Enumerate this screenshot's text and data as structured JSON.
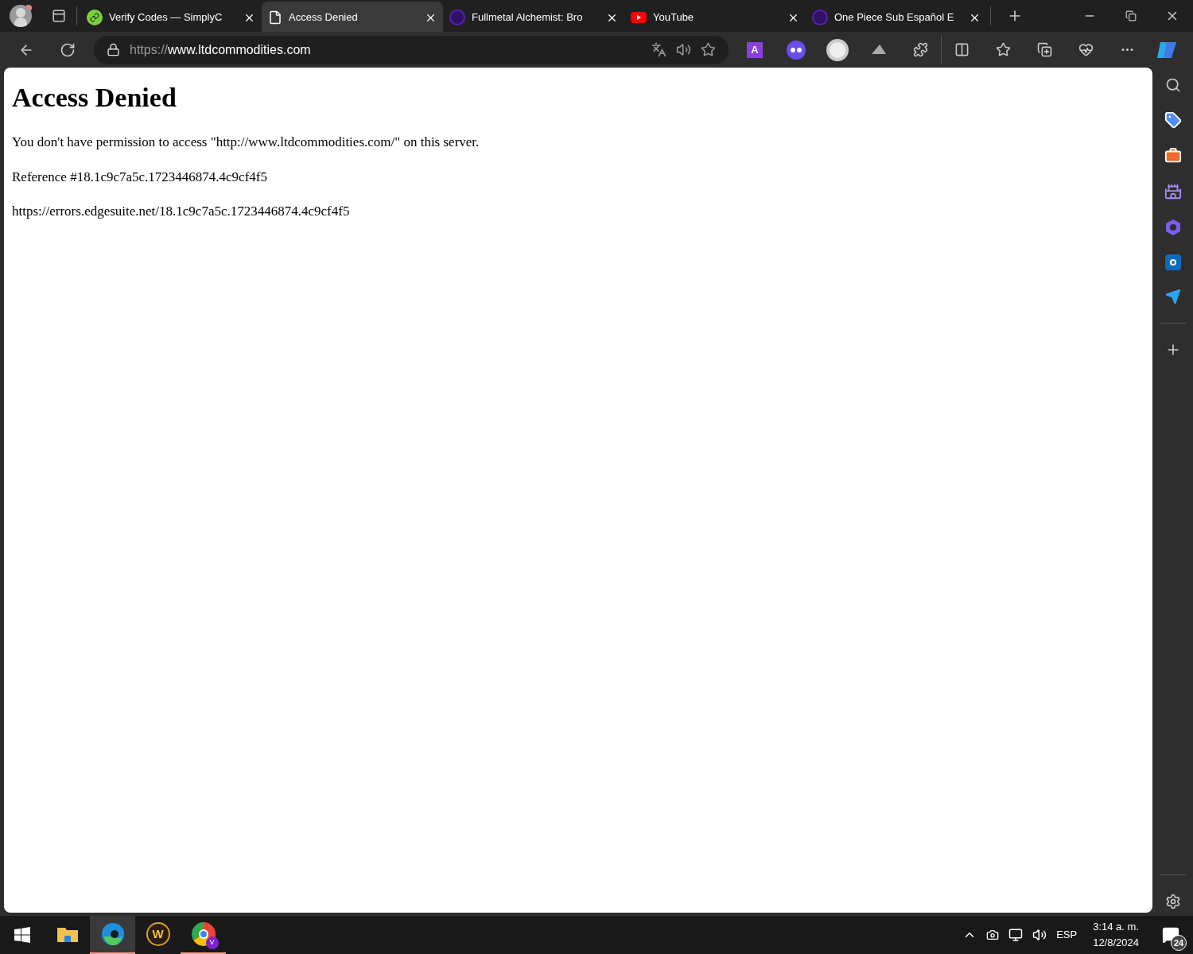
{
  "tabs": [
    {
      "title": "Verify Codes — SimplyC",
      "kind": "link",
      "selected": false
    },
    {
      "title": "Access Denied",
      "kind": "page",
      "selected": true
    },
    {
      "title": "Fullmetal Alchemist: Bro",
      "kind": "purple",
      "selected": false
    },
    {
      "title": "YouTube",
      "kind": "youtube",
      "selected": false
    },
    {
      "title": "One Piece Sub Español E",
      "kind": "purple",
      "selected": false
    }
  ],
  "address_bar": {
    "scheme": "https://",
    "host": "www.ltdcommodities.com"
  },
  "extension_badge": "A",
  "page": {
    "heading": "Access Denied",
    "paragraphs": [
      "You don't have permission to access \"http://www.ltdcommodities.com/\" on this server.",
      "Reference #18.1c9c7a5c.1723446874.4c9cf4f5",
      "https://errors.edgesuite.net/18.1c9c7a5c.1723446874.4c9cf4f5"
    ]
  },
  "taskbar": {
    "apps": [
      {
        "kind": "folder",
        "selected": false,
        "running": false
      },
      {
        "kind": "edge",
        "selected": true,
        "running": true
      },
      {
        "kind": "wow",
        "letter": "W",
        "selected": false,
        "running": false
      },
      {
        "kind": "chrome",
        "letter": "V",
        "selected": false,
        "running": true
      }
    ],
    "language": "ESP",
    "time": "3:14 a. m.",
    "date": "12/8/2024",
    "notifications": "24"
  }
}
